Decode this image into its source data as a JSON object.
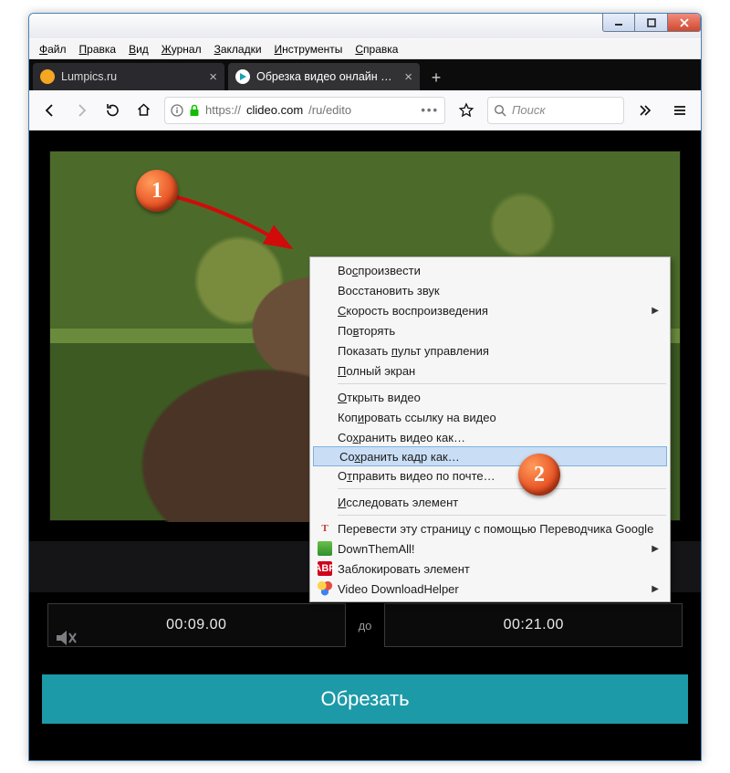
{
  "menubar": {
    "items": [
      "Файл",
      "Правка",
      "Вид",
      "Журнал",
      "Закладки",
      "Инструменты",
      "Справка"
    ]
  },
  "tabs": {
    "items": [
      {
        "title": "Lumpics.ru",
        "active": false
      },
      {
        "title": "Обрезка видео онлайн — Обр",
        "active": true
      }
    ]
  },
  "url": {
    "scheme": "https://",
    "host": "clideo.com",
    "path": "/ru/edito"
  },
  "search": {
    "placeholder": "Поиск"
  },
  "editor": {
    "time_from": "00:09.00",
    "time_to_label": "до",
    "time_to": "00:21.00",
    "cut_label": "Обрезать"
  },
  "contextmenu": {
    "items": [
      {
        "label": "Воспроизвести"
      },
      {
        "label": "Восстановить звук"
      },
      {
        "label": "Скорость воспроизведения",
        "submenu": true
      },
      {
        "label": "Повторять"
      },
      {
        "label": "Показать пульт управления"
      },
      {
        "label": "Полный экран"
      },
      {
        "sep": true
      },
      {
        "label": "Открыть видео"
      },
      {
        "label": "Копировать ссылку на видео"
      },
      {
        "label": "Сохранить видео как…"
      },
      {
        "label": "Сохранить кадр как…",
        "highlight": true
      },
      {
        "label": "Отправить видео по почте…"
      },
      {
        "sep": true
      },
      {
        "label": "Исследовать элемент"
      },
      {
        "sep": true
      },
      {
        "label": "Перевести эту страницу с помощью Переводчика Google",
        "icon": "t"
      },
      {
        "label": "DownThemAll!",
        "icon": "dta",
        "submenu": true
      },
      {
        "label": "Заблокировать элемент",
        "icon": "abp"
      },
      {
        "label": "Video DownloadHelper",
        "icon": "vdh",
        "submenu": true
      }
    ]
  },
  "annotations": {
    "b1": "1",
    "b2": "2"
  }
}
